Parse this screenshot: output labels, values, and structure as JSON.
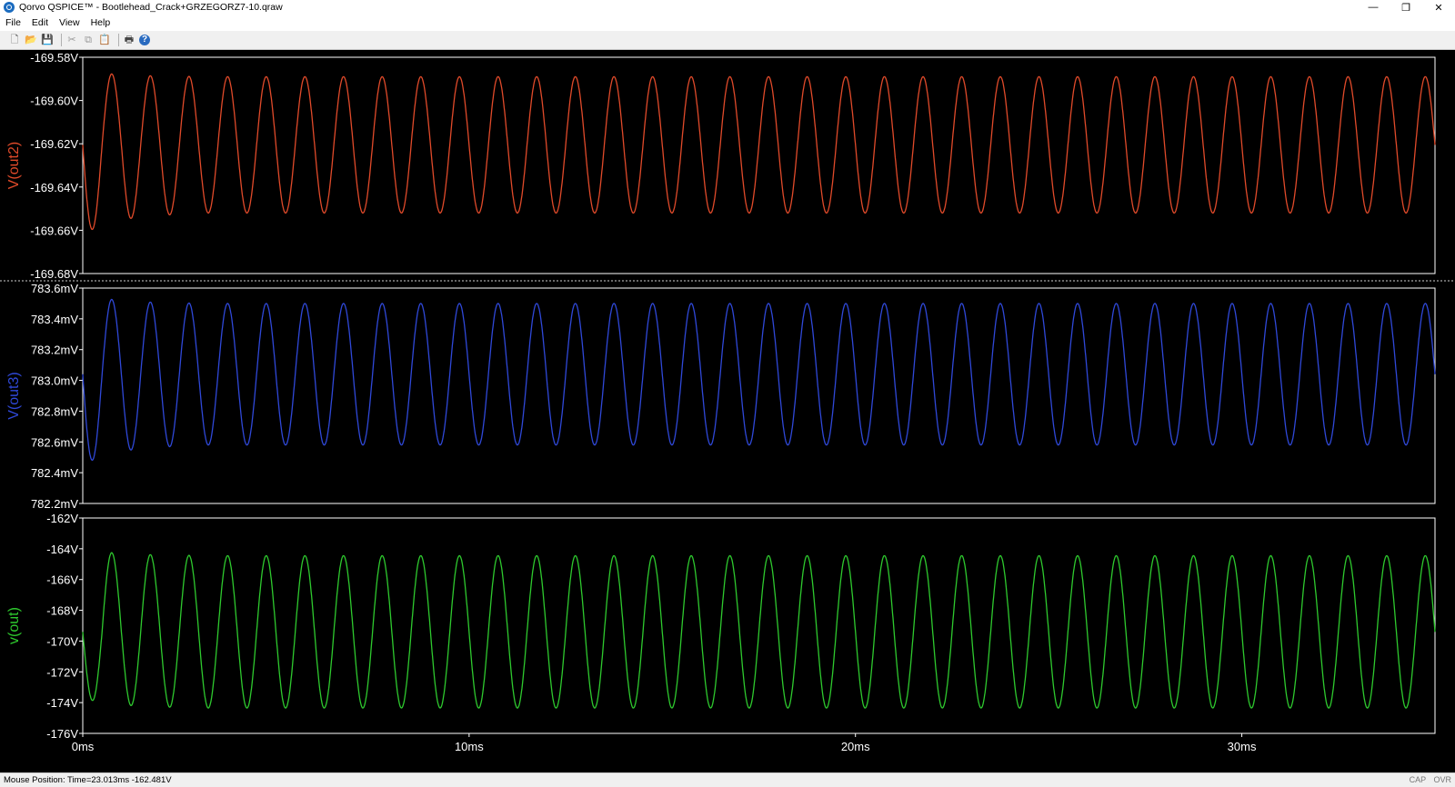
{
  "window": {
    "title": "Qorvo QSPICE™ - Bootlehead_Crack+GRZEGORZ7-10.qraw",
    "minimize_glyph": "—",
    "restore_glyph": "❐",
    "close_glyph": "✕"
  },
  "menu": [
    "File",
    "Edit",
    "View",
    "Help"
  ],
  "toolbar": {
    "icons": [
      "new-file-icon",
      "open-folder-icon",
      "save-icon",
      "cut-icon",
      "copy-icon",
      "paste-icon",
      "print-icon",
      "help-icon"
    ],
    "glyphs": [
      "🗋",
      "📂",
      "💾",
      "✂",
      "⧉",
      "📋",
      "🖶",
      "?"
    ]
  },
  "chart_data": [
    {
      "type": "line",
      "ylabel": "V(out2)",
      "color": "#e04a2a",
      "yticks": [
        "-169.58V",
        "-169.60V",
        "-169.62V",
        "-169.64V",
        "-169.66V",
        "-169.68V"
      ],
      "ylim": [
        -169.68,
        -169.58
      ],
      "xlim": [
        0,
        35
      ],
      "waveform": {
        "offset": -169.6205,
        "amplitude": 0.0315,
        "period_ms": 1.0,
        "start_phase_deg": 0,
        "initial_phase_note_shown": false,
        "first_dip": -169.662,
        "first_peak": -169.586
      }
    },
    {
      "type": "line",
      "ylabel": "V(out3)",
      "color": "#2f48d8",
      "yticks": [
        "783.6mV",
        "783.4mV",
        "783.2mV",
        "783.0mV",
        "782.8mV",
        "782.6mV",
        "782.4mV",
        "782.2mV"
      ],
      "ylim": [
        782.2,
        783.6
      ],
      "xlim": [
        0,
        35
      ],
      "waveform": {
        "offset": 783.04,
        "amplitude": 0.46,
        "period_ms": 1.0,
        "first_dip": 782.45,
        "first_peak": 783.56
      }
    },
    {
      "type": "line",
      "ylabel": "v(out)",
      "color": "#2ec92e",
      "yticks": [
        "-162V",
        "-164V",
        "-166V",
        "-168V",
        "-170V",
        "-172V",
        "-174V",
        "-176V"
      ],
      "ylim": [
        -176,
        -162
      ],
      "xlim": [
        0,
        35
      ],
      "waveform": {
        "offset": -169.4,
        "amplitude": 4.95,
        "period_ms": 1.0,
        "first_dip": -173.7,
        "first_peak": -164.0
      },
      "xticks": [
        "0ms",
        "10ms",
        "20ms",
        "30ms"
      ],
      "xtick_values": [
        0,
        10,
        20,
        30
      ]
    }
  ],
  "status": {
    "mouse_position": "Mouse Position: Time=23.013ms  -162.481V",
    "cap": "CAP",
    "ovr": "OVR"
  },
  "colors": {
    "background": "#000000",
    "frame": "#ffffff",
    "divider": "#cfcfcf"
  }
}
